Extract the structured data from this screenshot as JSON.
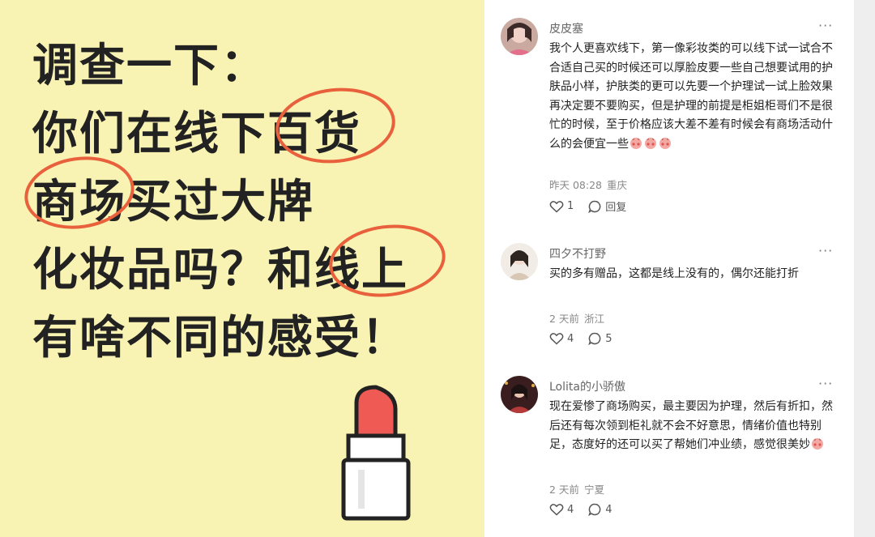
{
  "poster": {
    "lines": [
      "调查一下：",
      "你们在线下百货",
      "商场买过大牌",
      "化妆品吗？和线上",
      "有啥不同的感受！"
    ],
    "background_color": "#f9f3b3",
    "circle_color": "#e8603c",
    "lipstick_color": "#ef5a55"
  },
  "comments": [
    {
      "username": "皮皮塞",
      "text": "我个人更喜欢线下，第一像彩妆类的可以线下试一试合不合适自己买的时候还可以厚脸皮要一些自己想要试用的护肤品小样，护肤类的更可以先要一个护理试一试上脸效果再决定要不要购买，但是护理的前提是柜姐柜哥们不是很忙的时候，至于价格应该大差不差有时候会有商场活动什么的会便宜一些",
      "emoji_count": 3,
      "time": "昨天 08:28",
      "location": "重庆",
      "likes": "1",
      "reply_label": "回复"
    },
    {
      "username": "四夕不打野",
      "text": "买的多有赠品，这都是线上没有的，偶尔还能打折",
      "emoji_count": 0,
      "time": "2 天前",
      "location": "浙江",
      "likes": "4",
      "replies": "5"
    },
    {
      "username": "Lolita的小骄傲",
      "text": "现在爱惨了商场购买，最主要因为护理，然后有折扣，然后还有每次领到柜礼就不会不好意思，情绪价值也特别足，态度好的还可以买了帮她们冲业绩，感觉很美妙",
      "emoji_count": 1,
      "time": "2 天前",
      "location": "宁夏",
      "likes": "4",
      "replies": "4"
    }
  ],
  "icons": {
    "more": "more-dots-icon",
    "like": "heart-icon",
    "reply": "comment-bubble-icon"
  }
}
